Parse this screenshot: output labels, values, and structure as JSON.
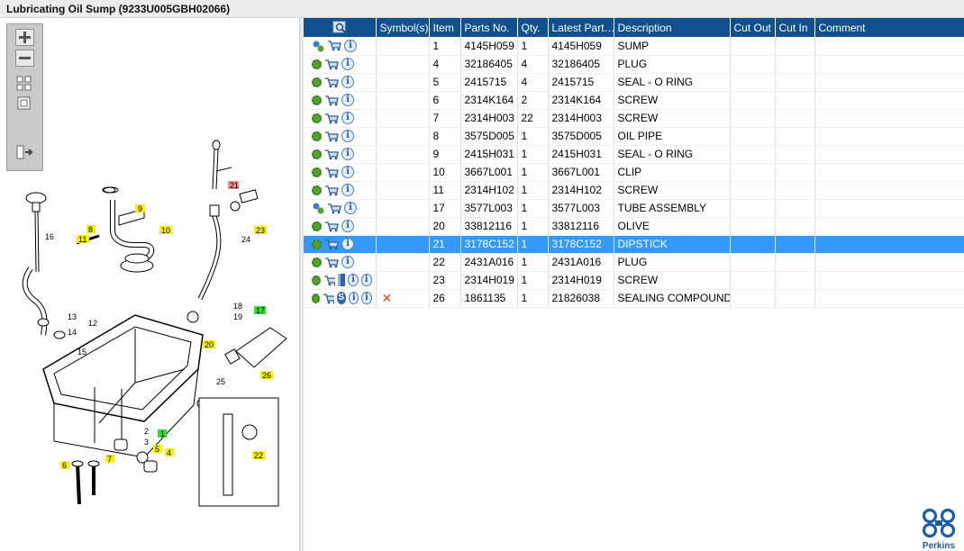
{
  "window": {
    "title": "Lubricating Oil Sump (9233U005GBH02066)"
  },
  "toolbar": {
    "buttons": [
      {
        "name": "zoom-in",
        "icon": "plus-icon"
      },
      {
        "name": "zoom-out",
        "icon": "minus-icon"
      },
      {
        "name": "fit-all",
        "icon": "grid-icon"
      },
      {
        "name": "actual-size",
        "icon": "square-icon"
      },
      {
        "name": "export",
        "icon": "export-icon"
      }
    ]
  },
  "diagram": {
    "callouts": [
      "1",
      "2",
      "3",
      "4",
      "5",
      "6",
      "7",
      "8",
      "9",
      "10",
      "11",
      "12",
      "13",
      "14",
      "15",
      "16",
      "17",
      "18",
      "19",
      "20",
      "21",
      "22",
      "23",
      "24",
      "25",
      "26"
    ],
    "highlight_colors": {
      "yellow": "#f7f200",
      "red": "#f08b8b",
      "green": "#33dd33"
    }
  },
  "table": {
    "columns": [
      "",
      "Symbol(s)",
      "Item",
      "Parts No.",
      "Qty.",
      "Latest Part…",
      "Description",
      "Cut Out",
      "Cut In",
      "Comment"
    ],
    "rows": [
      {
        "item": "1",
        "part": "4145H059",
        "qty": "1",
        "latest": "4145H059",
        "desc": "SUMP",
        "gear": "multi",
        "extra": "",
        "sym": ""
      },
      {
        "item": "4",
        "part": "32186405",
        "qty": "4",
        "latest": "32186405",
        "desc": "PLUG",
        "gear": "single",
        "extra": "",
        "sym": ""
      },
      {
        "item": "5",
        "part": "2415715",
        "qty": "4",
        "latest": "2415715",
        "desc": "SEAL - O RING",
        "gear": "single",
        "extra": "",
        "sym": ""
      },
      {
        "item": "6",
        "part": "2314K164",
        "qty": "2",
        "latest": "2314K164",
        "desc": "SCREW",
        "gear": "single",
        "extra": "",
        "sym": ""
      },
      {
        "item": "7",
        "part": "2314H003",
        "qty": "22",
        "latest": "2314H003",
        "desc": "SCREW",
        "gear": "single",
        "extra": "",
        "sym": ""
      },
      {
        "item": "8",
        "part": "3575D005",
        "qty": "1",
        "latest": "3575D005",
        "desc": "OIL PIPE",
        "gear": "single",
        "extra": "",
        "sym": ""
      },
      {
        "item": "9",
        "part": "2415H031",
        "qty": "1",
        "latest": "2415H031",
        "desc": "SEAL - O RING",
        "gear": "single",
        "extra": "",
        "sym": ""
      },
      {
        "item": "10",
        "part": "3667L001",
        "qty": "1",
        "latest": "3667L001",
        "desc": "CLIP",
        "gear": "single",
        "extra": "",
        "sym": ""
      },
      {
        "item": "11",
        "part": "2314H102",
        "qty": "1",
        "latest": "2314H102",
        "desc": "SCREW",
        "gear": "single",
        "extra": "",
        "sym": ""
      },
      {
        "item": "17",
        "part": "3577L003",
        "qty": "1",
        "latest": "3577L003",
        "desc": "TUBE ASSEMBLY",
        "gear": "multi",
        "extra": "",
        "sym": ""
      },
      {
        "item": "20",
        "part": "33812116",
        "qty": "1",
        "latest": "33812116",
        "desc": "OLIVE",
        "gear": "single",
        "extra": "",
        "sym": ""
      },
      {
        "item": "21",
        "part": "3178C152",
        "qty": "1",
        "latest": "3178C152",
        "desc": "DIPSTICK",
        "gear": "single",
        "extra": "",
        "sym": "",
        "selected": true
      },
      {
        "item": "22",
        "part": "2431A016",
        "qty": "1",
        "latest": "2431A016",
        "desc": "PLUG",
        "gear": "single",
        "extra": "",
        "sym": ""
      },
      {
        "item": "23",
        "part": "2314H019",
        "qty": "1",
        "latest": "2314H019",
        "desc": "SCREW",
        "gear": "single",
        "extra": "book-s",
        "sym": ""
      },
      {
        "item": "26",
        "part": "1861135",
        "qty": "1",
        "latest": "21826038",
        "desc": "SEALING COMPOUND",
        "gear": "single",
        "extra": "s",
        "sym": "x"
      }
    ]
  },
  "brand": {
    "name": "Perkins",
    "color": "#1a5ea8"
  },
  "colors": {
    "header": "#10508e",
    "selection": "#3399ff"
  }
}
